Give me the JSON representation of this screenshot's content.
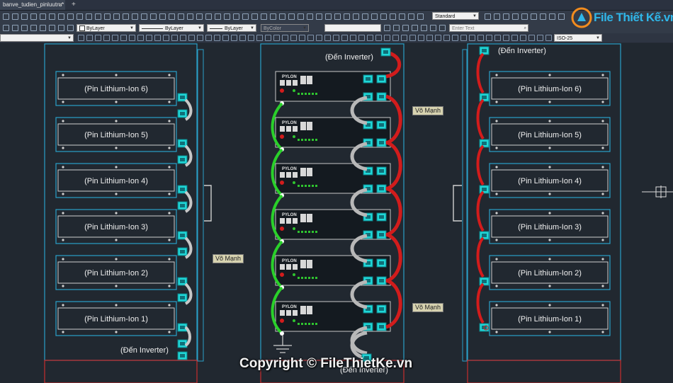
{
  "tab": {
    "title": "banve_tudien_pinluutru*",
    "close": "×",
    "add": "+"
  },
  "toolbar": {
    "text_style": "Standard",
    "layer_color": "ByLayer",
    "linetype": "ByLayer",
    "lineweight": "ByLayer",
    "plot_style": "ByColor",
    "search_placeholder": "Enter Text",
    "dim_style": "ISO-25"
  },
  "drawing": {
    "left_cabinet_batteries": [
      "(Pin Lithium-Ion 6)",
      "(Pin Lithium-Ion 5)",
      "(Pin Lithium-Ion 4)",
      "(Pin Lithium-Ion 3)",
      "(Pin Lithium-Ion 2)",
      "(Pin Lithium-Ion 1)"
    ],
    "right_cabinet_batteries": [
      "(Pin Lithium-Ion 6)",
      "(Pin Lithium-Ion 5)",
      "(Pin Lithium-Ion 4)",
      "(Pin Lithium-Ion 3)",
      "(Pin Lithium-Ion 2)",
      "(Pin Lithium-Ion 1)"
    ],
    "left_inverter_label": "(Đến Inverter)",
    "center_top_inverter_label": "(Đến Inverter)",
    "center_bottom_inverter_label": "(Đến Inverter)",
    "right_inverter_label": "(Đến Inverter)",
    "shell_label_center": "Võ Mạnh",
    "shell_label_left": "Võ Mạnh",
    "shell_label_bottom": "Võ Mạnh",
    "module_brand": "PYLON"
  },
  "watermark": {
    "logo": "File Thiết Kế.vn",
    "copyright": "Copyright © FileThietKe.vn"
  }
}
